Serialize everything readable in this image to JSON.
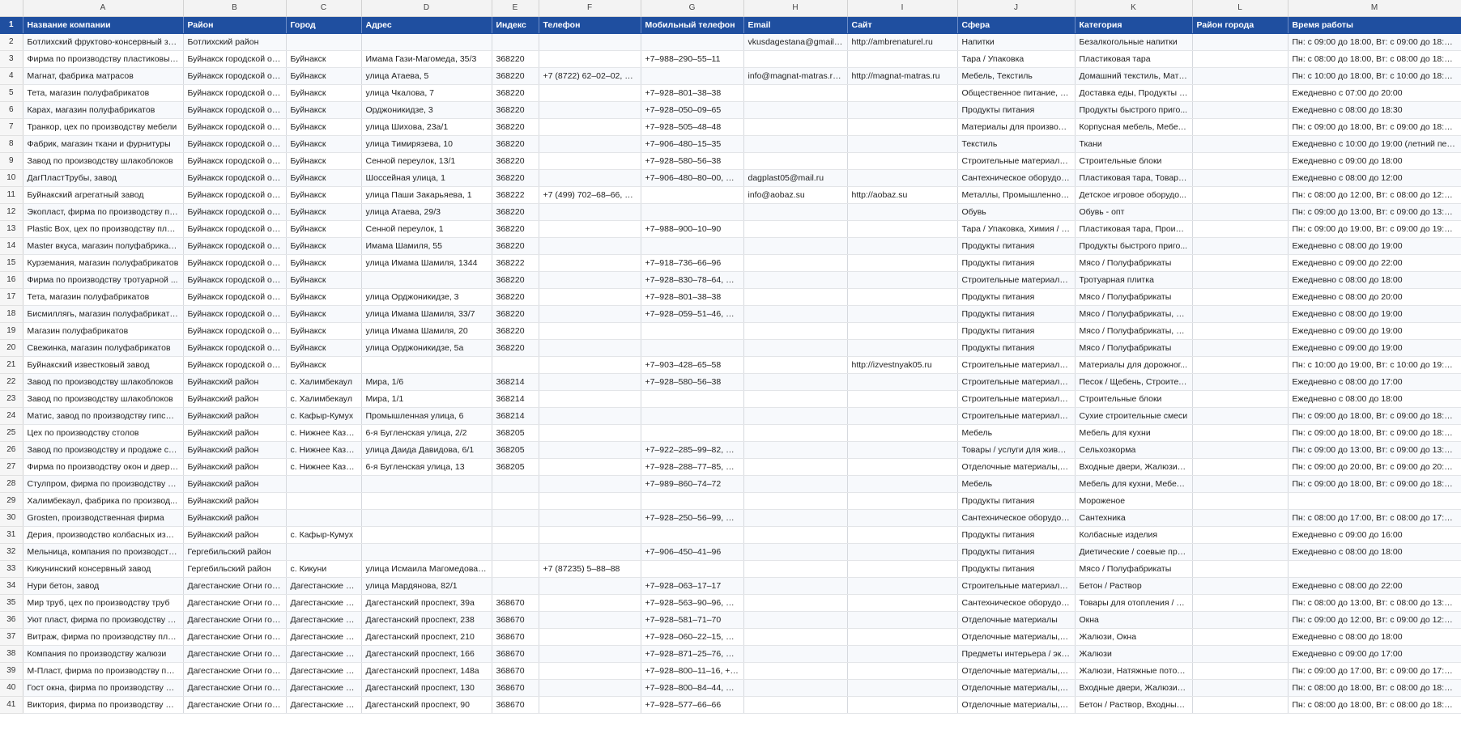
{
  "columns": [
    "A",
    "B",
    "C",
    "D",
    "E",
    "F",
    "G",
    "H",
    "I",
    "J",
    "K",
    "L",
    "M"
  ],
  "headers": [
    "Название компании",
    "Район",
    "Город",
    "Адрес",
    "Индекс",
    "Телефон",
    "Мобильный телефон",
    "Email",
    "Сайт",
    "Сфера",
    "Категория",
    "Район города",
    "Время работы"
  ],
  "header_row_number": "1",
  "rows": [
    {
      "n": "2",
      "c": [
        "Ботлихский фруктово-консервный за...",
        "Ботлихский район",
        "",
        "",
        "",
        "",
        "",
        "vkusdagestana@gmail.c...",
        "http://ambrenaturel.ru",
        "Напитки",
        "Безалкогольные напитки",
        "",
        "Пн: с 09:00 до 18:00, Вт: с 09:00 до 18:00, С..."
      ]
    },
    {
      "n": "3",
      "c": [
        "Фирма по производству пластиковых...",
        "Буйнакск городской ок...",
        "Буйнакск",
        "Имама Гази-Магомеда, 35/3",
        "368220",
        "",
        "+7–988–290–55–11",
        "",
        "",
        "Тара / Упаковка",
        "Пластиковая тара",
        "",
        "Пн: с 08:00 до 18:00, Вт: с 08:00 до 18:00, С..."
      ]
    },
    {
      "n": "4",
      "c": [
        "Магнат, фабрика матрасов",
        "Буйнакск городской ок...",
        "Буйнакск",
        "улица Атаева, 5",
        "368220",
        "+7 (8722) 62–02–02, 8–...",
        "",
        "info@magnat-matras.ru...",
        "http://magnat-matras.ru",
        "Мебель, Текстиль",
        "Домашний текстиль, Матр...",
        "",
        "Пн: с 10:00 до 18:00, Вт: с 10:00 до 18:00, С..."
      ]
    },
    {
      "n": "5",
      "c": [
        "Тета, магазин полуфабрикатов",
        "Буйнакск городской ок...",
        "Буйнакск",
        "улица Чкалова, 7",
        "368220",
        "",
        "+7–928–801–38–38",
        "",
        "",
        "Общественное питание, П...",
        "Доставка еды, Продукты б...",
        "",
        "Ежедневно с 07:00 до 20:00"
      ]
    },
    {
      "n": "6",
      "c": [
        "Карах, магазин полуфабрикатов",
        "Буйнакск городской ок...",
        "Буйнакск",
        "Орджоникидзе, 3",
        "368220",
        "",
        "+7–928–050–09–65",
        "",
        "",
        "Продукты питания",
        "Продукты быстрого приго...",
        "",
        "Ежедневно с 08:00 до 18:30"
      ]
    },
    {
      "n": "7",
      "c": [
        "Транкор, цех по производству мебели",
        "Буйнакск городской ок...",
        "Буйнакск",
        "улица Шихова, 23а/1",
        "368220",
        "",
        "+7–928–505–48–48",
        "",
        "",
        "Материалы для производс...",
        "Корпусная мебель, Мебел...",
        "",
        "Пн: с 09:00 до 18:00, Вт: с 09:00 до 18:00, С..."
      ]
    },
    {
      "n": "8",
      "c": [
        "Фабрик, магазин ткани и фурнитуры",
        "Буйнакск городской ок...",
        "Буйнакск",
        "улица Тимирязева, 10",
        "368220",
        "",
        "+7–906–480–15–35",
        "",
        "",
        "Текстиль",
        "Ткани",
        "",
        "Ежедневно с 10:00 до 19:00 (летний пери..."
      ]
    },
    {
      "n": "9",
      "c": [
        "Завод по производству шлакоблоков",
        "Буйнакск городской ок...",
        "Буйнакск",
        "Сенной переулок, 13/1",
        "368220",
        "",
        "+7–928–580–56–38",
        "",
        "",
        "Строительные материалы ...",
        "Строительные блоки",
        "",
        "Ежедневно с 09:00 до 18:00"
      ]
    },
    {
      "n": "10",
      "c": [
        "ДагПластТрубы, завод",
        "Буйнакск городской ок...",
        "Буйнакск",
        "Шоссейная улица, 1",
        "368220",
        "",
        "+7–906–480–80–00, +7...",
        "dagplast05@mail.ru",
        "",
        "Сантехническое оборудов...",
        "Пластиковая тара, Товары ...",
        "",
        "Ежедневно с 08:00 до 12:00"
      ]
    },
    {
      "n": "11",
      "c": [
        "Буйнакский агрегатный завод",
        "Буйнакск городской ок...",
        "Буйнакск",
        "улица Паши Закарьяева, 1",
        "368222",
        "+7 (499) 702–68–66, +7...",
        "",
        "info@aobaz.su",
        "http://aobaz.su",
        "Металлы, Промышленное ...",
        "Детское игровое оборудо...",
        "",
        "Пн: с 08:00 до 12:00, Вт: с 08:00 до 12:00, С..."
      ]
    },
    {
      "n": "12",
      "c": [
        "Экопласт, фирма по производству по...",
        "Буйнакск городской ок...",
        "Буйнакск",
        "улица Атаева, 29/3",
        "368220",
        "",
        "",
        "",
        "",
        "Обувь",
        "Обувь - опт",
        "",
        "Пн: с 09:00 до 13:00, Вт: с 09:00 до 13:00, С..."
      ]
    },
    {
      "n": "13",
      "c": [
        "Plastic Box, цех по производству плас...",
        "Буйнакск городской ок...",
        "Буйнакск",
        "Сенной переулок, 1",
        "368220",
        "",
        "+7–988–900–10–90",
        "",
        "",
        "Тара / Упаковка, Химия / В...",
        "Пластиковая тара, Произв...",
        "",
        "Пн: с 09:00 до 19:00, Вт: с 09:00 до 19:00, С..."
      ]
    },
    {
      "n": "14",
      "c": [
        "Master вкуса, магазин полуфабрикатов",
        "Буйнакск городской ок...",
        "Буйнакск",
        "Имама Шамиля, 55",
        "368220",
        "",
        "",
        "",
        "",
        "Продукты питания",
        "Продукты быстрого приго...",
        "",
        "Ежедневно с 08:00 до 19:00"
      ]
    },
    {
      "n": "15",
      "c": [
        "Курземания, магазин полуфабрикатов",
        "Буйнакск городской ок...",
        "Буйнакск",
        "улица Имама Шамиля, 1344",
        "368222",
        "",
        "+7–918–736–66–96",
        "",
        "",
        "Продукты питания",
        "Мясо / Полуфабрикаты",
        "",
        "Ежедневно с 09:00 до 22:00"
      ]
    },
    {
      "n": "16",
      "c": [
        "Фирма по производству тротуарной ...",
        "Буйнакск городской ок...",
        "Буйнакск",
        "",
        "368220",
        "",
        "+7–928–830–78–64, +7...",
        "",
        "",
        "Строительные материалы ...",
        "Тротуарная плитка",
        "",
        "Ежедневно с 08:00 до 18:00"
      ]
    },
    {
      "n": "17",
      "c": [
        "Тета, магазин полуфабрикатов",
        "Буйнакск городской ок...",
        "Буйнакск",
        "улица Орджоникидзе, 3",
        "368220",
        "",
        "+7–928–801–38–38",
        "",
        "",
        "Продукты питания",
        "Мясо / Полуфабрикаты",
        "",
        "Ежедневно с 08:00 до 20:00"
      ]
    },
    {
      "n": "18",
      "c": [
        "Бисмиллягь, магазин полуфабрикатов",
        "Буйнакск городской ок...",
        "Буйнакск",
        "улица Имама Шамиля, 33/7",
        "368220",
        "",
        "+7–928–059–51–46, +7...",
        "",
        "",
        "Продукты питания",
        "Мясо / Полуфабрикаты, П...",
        "",
        "Ежедневно с 08:00 до 19:00"
      ]
    },
    {
      "n": "19",
      "c": [
        "Магазин полуфабрикатов",
        "Буйнакск городской ок...",
        "Буйнакск",
        "улица Имама Шамиля, 20",
        "368220",
        "",
        "",
        "",
        "",
        "Продукты питания",
        "Мясо / Полуфабрикаты, М...",
        "",
        "Ежедневно с 09:00 до 19:00"
      ]
    },
    {
      "n": "20",
      "c": [
        "Свежинка, магазин полуфабрикатов",
        "Буйнакск городской ок...",
        "Буйнакск",
        "улица Орджоникидзе, 5а",
        "368220",
        "",
        "",
        "",
        "",
        "Продукты питания",
        "Мясо / Полуфабрикаты",
        "",
        "Ежедневно с 09:00 до 19:00"
      ]
    },
    {
      "n": "21",
      "c": [
        "Буйнакский известковый завод",
        "Буйнакск городской ок...",
        "Буйнакск",
        "",
        "",
        "",
        "+7–903–428–65–58",
        "",
        "http://izvestnyak05.ru",
        "Строительные материалы ...",
        "Материалы для дорожног...",
        "",
        "Пн: с 10:00 до 19:00, Вт: с 10:00 до 19:00, С..."
      ]
    },
    {
      "n": "22",
      "c": [
        "Завод по производству шлакоблоков",
        "Буйнакский район",
        "с. Халимбекаул",
        "Мира, 1/6",
        "368214",
        "",
        "+7–928–580–56–38",
        "",
        "",
        "Строительные материалы ...",
        "Песок / Щебень, Строител...",
        "",
        "Ежедневно с 08:00 до 17:00"
      ]
    },
    {
      "n": "23",
      "c": [
        "Завод по производству шлакоблоков",
        "Буйнакский район",
        "с. Халимбекаул",
        "Мира, 1/1",
        "368214",
        "",
        "",
        "",
        "",
        "Строительные материалы ...",
        "Строительные блоки",
        "",
        "Ежедневно с 08:00 до 18:00"
      ]
    },
    {
      "n": "24",
      "c": [
        "Матис, завод по производству гипсов...",
        "Буйнакский район",
        "с. Кафыр-Кумух",
        "Промышленная улица, 6",
        "368214",
        "",
        "",
        "",
        "",
        "Строительные материалы ...",
        "Сухие строительные смеси",
        "",
        "Пн: с 09:00 до 18:00, Вт: с 09:00 до 18:00, С..."
      ]
    },
    {
      "n": "25",
      "c": [
        "Цех по производству столов",
        "Буйнакский район",
        "с. Нижнее Каза...",
        "6-я Бугленская улица, 2/2",
        "368205",
        "",
        "",
        "",
        "",
        "Мебель",
        "Мебель для кухни",
        "",
        "Пн: с 09:00 до 18:00, Вт: с 09:00 до 18:00, С..."
      ]
    },
    {
      "n": "26",
      "c": [
        "Завод по производству и продаже се...",
        "Буйнакский район",
        "с. Нижнее Каза...",
        "улица Даида Давидова, 6/1",
        "368205",
        "",
        "+7–922–285–99–82, +7...",
        "",
        "",
        "Товары / услуги для живот...",
        "Сельхозкорма",
        "",
        "Пн: с 09:00 до 13:00, Вт: с 09:00 до 13:00, С..."
      ]
    },
    {
      "n": "27",
      "c": [
        "Фирма по производству окон и дверей",
        "Буйнакский район",
        "с. Нижнее Каза...",
        "6-я Бугленская улица, 13",
        "368205",
        "",
        "+7–928–288–77–85, +7...",
        "",
        "",
        "Отделочные материалы, П...",
        "Входные двери, Жалюзи, ...",
        "",
        "Пн: с 09:00 до 20:00, Вт: с 09:00 до 20:00, С..."
      ]
    },
    {
      "n": "28",
      "c": [
        "Стулпром, фирма по производству ст...",
        "Буйнакский район",
        "",
        "",
        "",
        "",
        "+7–989–860–74–72",
        "",
        "",
        "Мебель",
        "Мебель для кухни, Мебель...",
        "",
        "Пн: с 09:00 до 18:00, Вт: с 09:00 до 18:00, С..."
      ]
    },
    {
      "n": "29",
      "c": [
        "Халимбекаул, фабрика по производ...",
        "Буйнакский район",
        "",
        "",
        "",
        "",
        "",
        "",
        "",
        "Продукты питания",
        "Мороженое",
        "",
        ""
      ]
    },
    {
      "n": "30",
      "c": [
        "Grosten, производственная фирма",
        "Буйнакский район",
        "",
        "",
        "",
        "",
        "+7–928–250–56–99, +7...",
        "",
        "",
        "Сантехническое оборудов...",
        "Сантехника",
        "",
        "Пн: с 08:00 до 17:00, Вт: с 08:00 до 17:00, С..."
      ]
    },
    {
      "n": "31",
      "c": [
        "Дерия, производство колбасных изде...",
        "Буйнакский район",
        "с. Кафыр-Кумух",
        "",
        "",
        "",
        "",
        "",
        "",
        "Продукты питания",
        "Колбасные изделия",
        "",
        "Ежедневно с 09:00 до 16:00"
      ]
    },
    {
      "n": "32",
      "c": [
        "Мельница, компания по производств...",
        "Гергебильский район",
        "",
        "",
        "",
        "",
        "+7–906–450–41–96",
        "",
        "",
        "Продукты питания",
        "Диетические / соевые про...",
        "",
        "Ежедневно с 08:00 до 18:00"
      ]
    },
    {
      "n": "33",
      "c": [
        "Кикунинский консервный завод",
        "Гергебильский район",
        "с. Кикуни",
        "улица Исмаила Магомедова, 13",
        "",
        "+7 (87235) 5–88–88",
        "",
        "",
        "",
        "Продукты питания",
        "Мясо / Полуфабрикаты",
        "",
        ""
      ]
    },
    {
      "n": "34",
      "c": [
        "Нури бетон, завод",
        "Дагестанские Огни гор...",
        "Дагестанские О...",
        "улица Мардянова, 82/1",
        "",
        "",
        "+7–928–063–17–17",
        "",
        "",
        "Строительные материалы ...",
        "Бетон / Раствор",
        "",
        "Ежедневно с 08:00 до 22:00"
      ]
    },
    {
      "n": "35",
      "c": [
        "Мир труб, цех по производству труб",
        "Дагестанские Огни гор...",
        "Дагестанские О...",
        "Дагестанский проспект, 39а",
        "368670",
        "",
        "+7–928–563–90–96, +7...",
        "",
        "",
        "Сантехническое оборудов...",
        "Товары для отопления / в...",
        "",
        "Пн: с 08:00 до 13:00, Вт: с 08:00 до 13:00, С..."
      ]
    },
    {
      "n": "36",
      "c": [
        "Уют пласт, фирма по производству п...",
        "Дагестанские Огни гор...",
        "Дагестанские О...",
        "Дагестанский проспект, 238",
        "368670",
        "",
        "+7–928–581–71–70",
        "",
        "",
        "Отделочные материалы",
        "Окна",
        "",
        "Пн: с 09:00 до 12:00, Вт: с 09:00 до 12:00, С..."
      ]
    },
    {
      "n": "37",
      "c": [
        "Витраж, фирма по производству плас...",
        "Дагестанские Огни гор...",
        "Дагестанские О...",
        "Дагестанский проспект, 210",
        "368670",
        "",
        "+7–928–060–22–15, +7...",
        "",
        "",
        "Отделочные материалы, П...",
        "Жалюзи, Окна",
        "",
        "Ежедневно с 08:00 до 18:00"
      ]
    },
    {
      "n": "38",
      "c": [
        "Компания по производству жалюзи",
        "Дагестанские Огни гор...",
        "Дагестанские О...",
        "Дагестанский проспект, 166",
        "368670",
        "",
        "+7–928–871–25–76, +7...",
        "",
        "",
        "Предметы интерьера / экс...",
        "Жалюзи",
        "",
        "Ежедневно с 09:00 до 17:00"
      ]
    },
    {
      "n": "39",
      "c": [
        "М-Пласт, фирма по производству пла...",
        "Дагестанские Огни гор...",
        "Дагестанские О...",
        "Дагестанский проспект, 148а",
        "368670",
        "",
        "+7–928–800–11–16, +7...",
        "",
        "",
        "Отделочные материалы, П...",
        "Жалюзи, Натяжные потол...",
        "",
        "Пн: с 09:00 до 17:00, Вт: с 09:00 до 17:00, С..."
      ]
    },
    {
      "n": "40",
      "c": [
        "Гост окна, фирма по производству ок...",
        "Дагестанские Огни гор...",
        "Дагестанские О...",
        "Дагестанский проспект, 130",
        "368670",
        "",
        "+7–928–800–84–44, +7...",
        "",
        "",
        "Отделочные материалы, П...",
        "Входные двери, Жалюзи, ...",
        "",
        "Пн: с 08:00 до 18:00, Вт: с 08:00 до 18:00, С..."
      ]
    },
    {
      "n": "41",
      "c": [
        "Виктория, фирма по производству пл...",
        "Дагестанские Огни гор...",
        "Дагестанские О...",
        "Дагестанский проспект, 90",
        "368670",
        "",
        "+7–928–577–66–66",
        "",
        "",
        "Отделочные материалы, П...",
        "Бетон / Раствор, Входные ...",
        "",
        "Пн: с 08:00 до 18:00, Вт: с 08:00 до 18:00, С..."
      ]
    }
  ]
}
